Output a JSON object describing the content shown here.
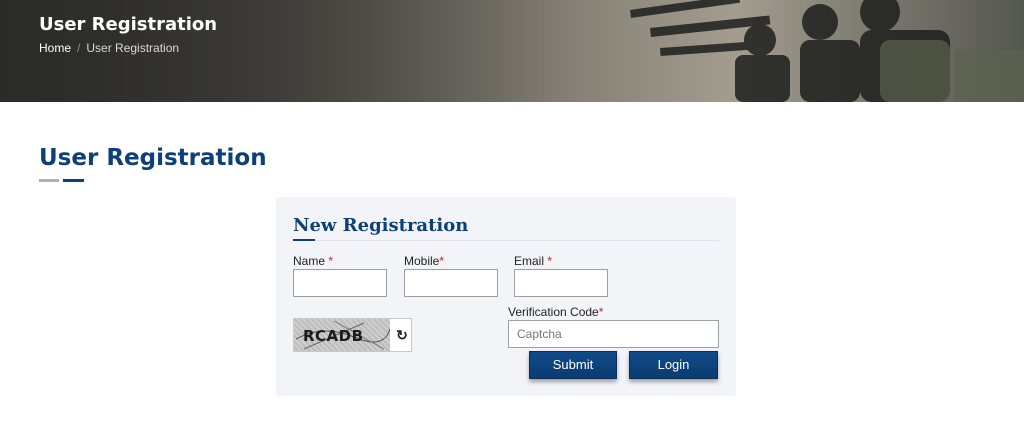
{
  "banner": {
    "title": "User Registration",
    "breadcrumb": {
      "home": "Home",
      "separator": "/",
      "current": "User Registration"
    }
  },
  "page": {
    "title": "User Registration"
  },
  "form": {
    "title": "New Registration",
    "name": {
      "label": "Name",
      "required": "*",
      "value": ""
    },
    "mobile": {
      "label": "Mobile",
      "required": "*",
      "value": ""
    },
    "email": {
      "label": "Email",
      "required": "*",
      "value": ""
    },
    "verification": {
      "label": "Verification Code",
      "required": "*",
      "placeholder": "Captcha",
      "value": ""
    },
    "captcha_text": "RCADB",
    "refresh_icon": "refresh-icon",
    "submit_label": "Submit",
    "login_label": "Login"
  },
  "colors": {
    "brand": "#0d3f7a",
    "required": "#c0262d",
    "card_bg": "#f2f4f8"
  }
}
